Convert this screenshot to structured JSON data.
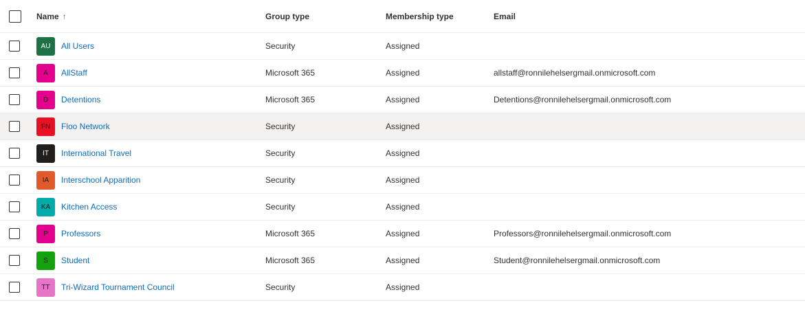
{
  "headers": {
    "name": "Name",
    "sort_indicator": "↑",
    "group_type": "Group type",
    "membership_type": "Membership type",
    "email": "Email"
  },
  "rows": [
    {
      "initials": "AU",
      "avatar_color": "#1e7145",
      "light": true,
      "name": "All Users",
      "group_type": "Security",
      "membership_type": "Assigned",
      "email": ""
    },
    {
      "initials": "A",
      "avatar_color": "#e3008c",
      "light": false,
      "name": "AllStaff",
      "group_type": "Microsoft 365",
      "membership_type": "Assigned",
      "email": "allstaff@ronnilehelsergmail.onmicrosoft.com"
    },
    {
      "initials": "D",
      "avatar_color": "#e3008c",
      "light": false,
      "name": "Detentions",
      "group_type": "Microsoft 365",
      "membership_type": "Assigned",
      "email": "Detentions@ronnilehelsergmail.onmicrosoft.com"
    },
    {
      "initials": "FN",
      "avatar_color": "#e81123",
      "light": false,
      "name": "Floo Network",
      "group_type": "Security",
      "membership_type": "Assigned",
      "email": ""
    },
    {
      "initials": "IT",
      "avatar_color": "#201f1e",
      "light": true,
      "name": "International Travel",
      "group_type": "Security",
      "membership_type": "Assigned",
      "email": ""
    },
    {
      "initials": "IA",
      "avatar_color": "#e05a2c",
      "light": false,
      "name": "Interschool Apparition",
      "group_type": "Security",
      "membership_type": "Assigned",
      "email": ""
    },
    {
      "initials": "KA",
      "avatar_color": "#00aba9",
      "light": false,
      "name": "Kitchen Access",
      "group_type": "Security",
      "membership_type": "Assigned",
      "email": ""
    },
    {
      "initials": "P",
      "avatar_color": "#e3008c",
      "light": false,
      "name": "Professors",
      "group_type": "Microsoft 365",
      "membership_type": "Assigned",
      "email": "Professors@ronnilehelsergmail.onmicrosoft.com"
    },
    {
      "initials": "S",
      "avatar_color": "#13a10e",
      "light": false,
      "name": "Student",
      "group_type": "Microsoft 365",
      "membership_type": "Assigned",
      "email": "Student@ronnilehelsergmail.onmicrosoft.com"
    },
    {
      "initials": "TT",
      "avatar_color": "#e675c8",
      "light": false,
      "name": "Tri-Wizard Tournament Council",
      "group_type": "Security",
      "membership_type": "Assigned",
      "email": ""
    }
  ],
  "hovered_row": "Floo Network"
}
